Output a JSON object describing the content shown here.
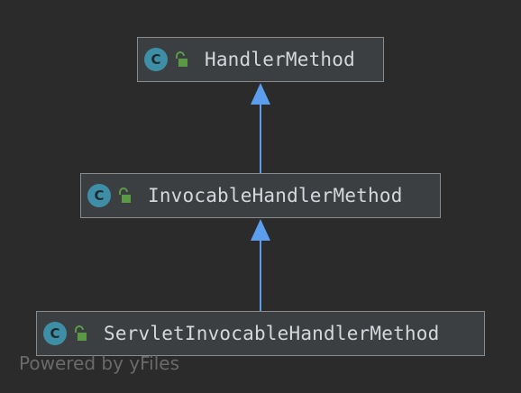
{
  "nodes": [
    {
      "label": "HandlerMethod",
      "badge": "C",
      "icon": "class-icon",
      "modifier_icon": "public-lock-icon"
    },
    {
      "label": "InvocableHandlerMethod",
      "badge": "C",
      "icon": "class-icon",
      "modifier_icon": "public-lock-icon"
    },
    {
      "label": "ServletInvocableHandlerMethod",
      "badge": "C",
      "icon": "class-icon",
      "modifier_icon": "public-lock-icon"
    }
  ],
  "edges": [
    {
      "from": "InvocableHandlerMethod",
      "to": "HandlerMethod",
      "relation": "extends"
    },
    {
      "from": "ServletInvocableHandlerMethod",
      "to": "InvocableHandlerMethod",
      "relation": "extends"
    }
  ],
  "watermark": "Powered by yFiles",
  "colors": {
    "background": "#2b2b2b",
    "node_fill": "#3c3f41",
    "node_border": "#8a8a8a",
    "class_badge": "#3f8ea8",
    "lock": "#5b9a45",
    "arrow": "#5c9ded",
    "label": "#d4d7dc"
  }
}
